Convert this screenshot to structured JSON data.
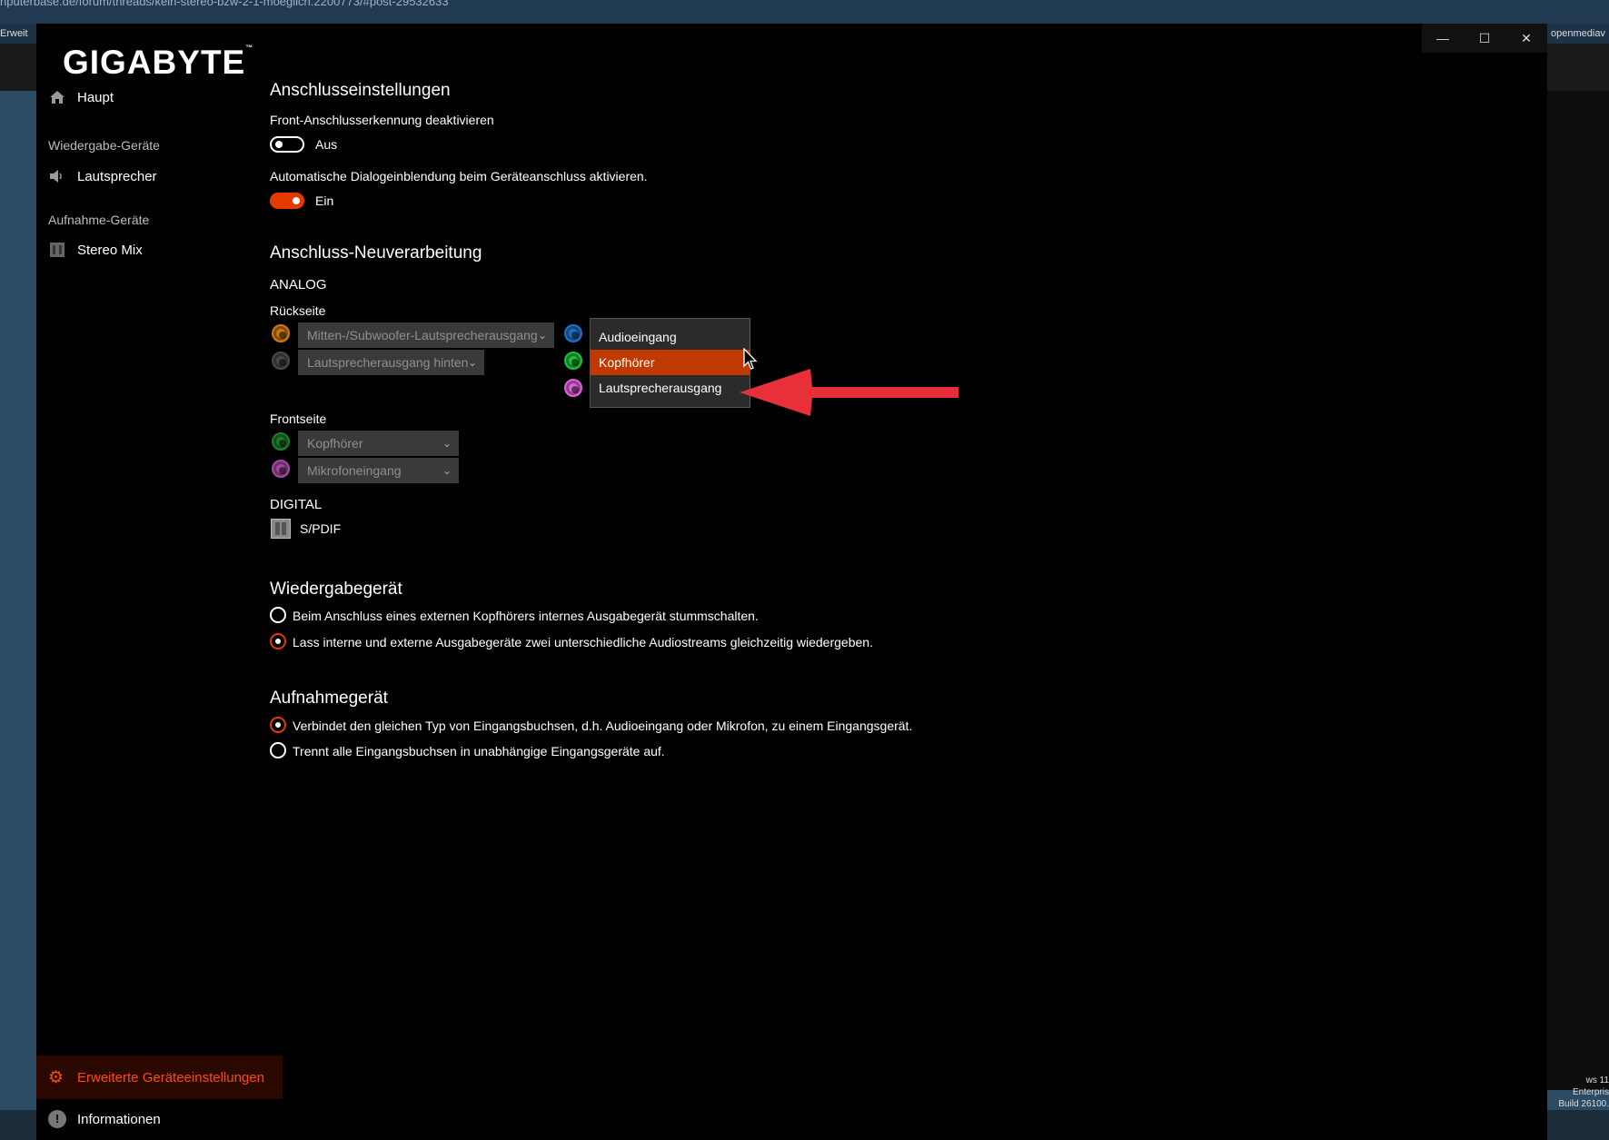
{
  "background": {
    "url": "nputerbase.de/forum/threads/kein-stereo-bzw-2-1-moeglich.2200773/#post-29532633",
    "left_tab": "Erweit",
    "right_tab": "openmediav",
    "win_edition": "ws 11 Enterpris",
    "win_build": "Build 26100."
  },
  "window": {
    "minimize_icon": "minimize-icon",
    "maximize_icon": "maximize-icon",
    "close_icon": "close-icon"
  },
  "logo": {
    "text": "GIGABYTE",
    "tm": "™"
  },
  "sidebar": {
    "main": "Haupt",
    "playback_header": "Wiedergabe-Geräte",
    "speaker": "Lautsprecher",
    "record_header": "Aufnahme-Geräte",
    "stereo_mix": "Stereo Mix",
    "advanced": "Erweiterte Geräteeinstellungen",
    "info": "Informationen"
  },
  "connector_settings": {
    "title": "Anschlusseinstellungen",
    "front_detect_label": "Front-Anschlusserkennung deaktivieren",
    "front_detect_state": "Aus",
    "auto_dialog_label": "Automatische Dialogeinblendung beim Geräteanschluss aktivieren.",
    "auto_dialog_state": "Ein"
  },
  "retasking": {
    "title": "Anschluss-Neuverarbeitung",
    "analog": "ANALOG",
    "rear": "Rückseite",
    "rear_jacks": [
      {
        "color": "#c87a12",
        "value": "Mitten-/Subwoofer-Lautsprecherausgang"
      },
      {
        "color": "#4a4a4a",
        "value": "Lautsprecherausgang hinten"
      }
    ],
    "rear_right_jacks": [
      {
        "color": "#1f6fc4"
      },
      {
        "color": "#1fbf3a"
      },
      {
        "color": "#e060d8"
      }
    ],
    "dropdown_options": [
      "Audioeingang",
      "Kopfhörer",
      "Lautsprecherausgang"
    ],
    "dropdown_selected": "Kopfhörer",
    "front": "Frontseite",
    "front_jacks": [
      {
        "color": "#1e7a2c",
        "value": "Kopfhörer"
      },
      {
        "color": "#a04aa0",
        "value": "Mikrofoneingang"
      }
    ],
    "digital": "DIGITAL",
    "spdif": "S/PDIF"
  },
  "playback_device": {
    "title": "Wiedergabegerät",
    "options": [
      "Beim Anschluss eines externen Kopfhörers internes Ausgabegerät stummschalten.",
      "Lass interne und externe Ausgabegeräte zwei unterschiedliche Audiostreams gleichzeitig wiedergeben."
    ],
    "selected_index": 1
  },
  "recording_device": {
    "title": "Aufnahmegerät",
    "options": [
      "Verbindet den gleichen Typ von Eingangsbuchsen, d.h. Audioeingang oder Mikrofon, zu einem Eingangsgerät.",
      "Trennt alle Eingangsbuchsen in unabhängige Eingangsgeräte auf."
    ],
    "selected_index": 0
  },
  "colors": {
    "accent": "#e63900",
    "arrow": "#e8303a"
  }
}
